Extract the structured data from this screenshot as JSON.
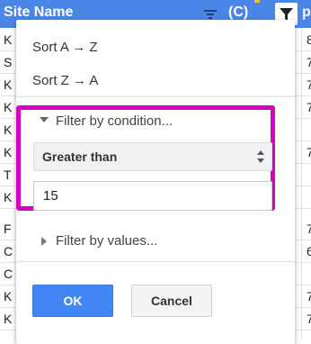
{
  "header": {
    "site_name": "Site Name",
    "col_c": "(C)",
    "col_p": "p"
  },
  "grid": {
    "col_a_chars": [
      "K",
      "S",
      "K",
      "K",
      "K",
      "K",
      "T",
      "K",
      "F",
      "C",
      "C",
      "K",
      "K"
    ],
    "col_b_chars": [
      "8",
      "7",
      "7",
      "7",
      "",
      "7",
      "",
      "",
      "7",
      "6",
      "",
      "7",
      "7"
    ]
  },
  "menu": {
    "sort_az": "Sort A → Z",
    "sort_za": "Sort Z → A",
    "filter_condition_label": "Filter by condition...",
    "condition_selected": "Greater than",
    "condition_value": "15",
    "filter_values_label": "Filter by values...",
    "ok_label": "OK",
    "cancel_label": "Cancel"
  },
  "colors": {
    "header_bg": "#4a86e8",
    "highlight": "#d400c4",
    "ok_bg": "#4285f4"
  }
}
